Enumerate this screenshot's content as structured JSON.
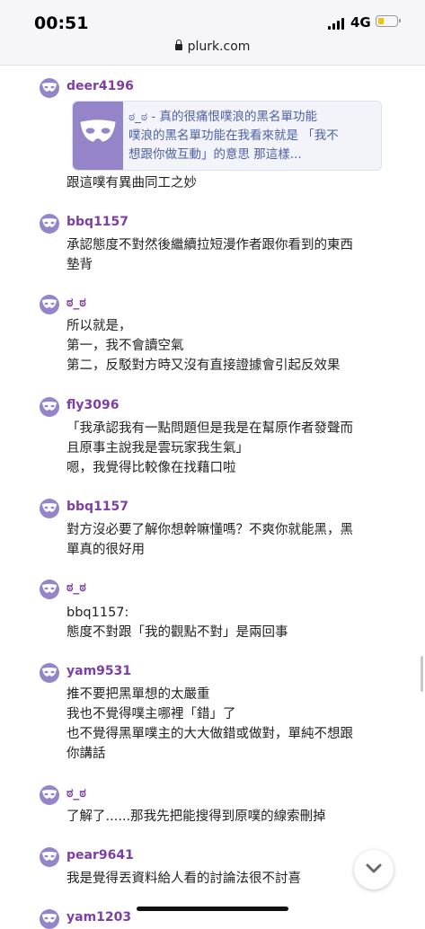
{
  "status_bar": {
    "time": "00:51",
    "network": "4G"
  },
  "browser": {
    "url": "plurk.com"
  },
  "link_card": {
    "lines": [
      "ಠ_ಠ - 真的很痛恨噗浪的黑名單功能",
      "噗浪的黑名單功能在我看來就是 「我不",
      "想跟你做互動」的意思 那這樣..."
    ]
  },
  "posts": [
    {
      "user": "deer4196",
      "lines": [
        "跟這噗有異曲同工之妙"
      ]
    },
    {
      "user": "bbq1157",
      "lines": [
        "承認態度不對然後繼續拉短漫作者跟你看到的東西",
        "墊背"
      ]
    },
    {
      "user": "ಠ_ಠ",
      "lines": [
        "所以就是，",
        "第一，我不會讀空氣",
        "第二，反駁對方時又沒有直接證據會引起反效果"
      ]
    },
    {
      "user": "fly3096",
      "lines": [
        "「我承認我有一點問題但是我是在幫原作者發聲而",
        "且原事主說我是雲玩家我生氣」",
        "嗯，我覺得比較像在找藉口啦"
      ]
    },
    {
      "user": "bbq1157",
      "lines": [
        "對方沒必要了解你想幹嘛懂嗎？不爽你就能黑，黑",
        "單真的很好用"
      ]
    },
    {
      "user": "ಠ_ಠ",
      "lines": [
        "bbq1157:",
        "態度不對跟「我的觀點不對」是兩回事"
      ]
    },
    {
      "user": "yam9531",
      "lines": [
        "推不要把黑單想的太嚴重",
        "我也不覺得噗主哪裡「錯」了",
        "也不覺得黑單噗主的大大做錯或做對，單純不想跟",
        "你講話"
      ]
    },
    {
      "user": "ಠ_ಠ",
      "lines": [
        "了解了......那我先把能搜得到原噗的線索刪掉"
      ]
    },
    {
      "user": "pear9641",
      "lines": [
        "我是覺得丟資料給人看的討論法很不討喜"
      ]
    },
    {
      "user": "yam1203",
      "lines": []
    }
  ],
  "colors": {
    "username": "#7d3fa3",
    "avatar": "#9585c8",
    "link": "#4f5fa4"
  },
  "icons": [
    "lock-icon",
    "mask-avatar-icon",
    "chevron-down-icon"
  ]
}
